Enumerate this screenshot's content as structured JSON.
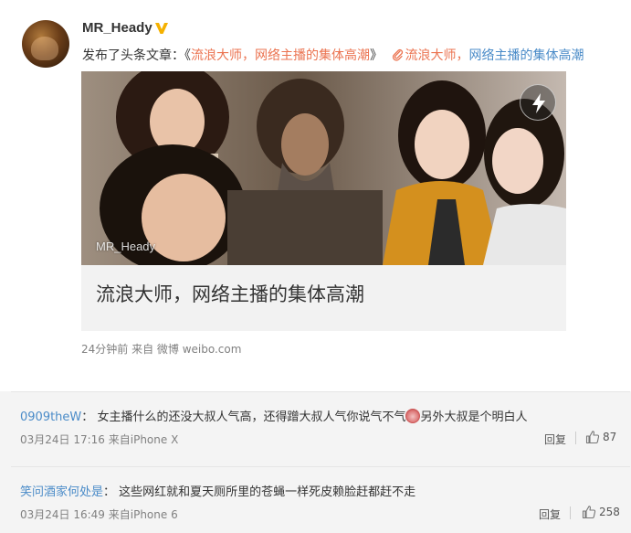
{
  "post": {
    "user_name": "MR_Heady",
    "action_text": "发布了头条文章：",
    "quote_open": "《",
    "quoted_title": "流浪大师，网络主播的集体高潮",
    "quote_close": "》",
    "link_part1": "流浪大师，",
    "link_part2": "网络主播的集体高潮",
    "article": {
      "watermark": "MR_Heady",
      "title": "流浪大师，网络主播的集体高潮"
    },
    "meta": "24分钟前 来自 微博 weibo.com"
  },
  "comments": [
    {
      "author": "0909theW",
      "separator": "：",
      "text_before_emoji": "女主播什么的还没大叔人气高，还得蹭大叔人气你说气不气",
      "text_after_emoji": "另外大叔是个明白人",
      "meta": "03月24日 17:16 来自iPhone X",
      "reply_label": "回复",
      "likes": "87"
    },
    {
      "author": "笑问酒家何处是",
      "separator": "：",
      "text_before_emoji": "这些网红就和夏天厕所里的苍蝇一样死皮赖脸赶都赶不走",
      "text_after_emoji": "",
      "meta": "03月24日 16:49 来自iPhone 6",
      "reply_label": "回复",
      "likes": "258"
    }
  ],
  "icons": {
    "vip": "vip-badge-icon",
    "clip": "link-clip-icon",
    "flash": "flash-icon",
    "like": "thumbs-up-icon",
    "emoji": "emoji-icon"
  },
  "colors": {
    "link_orange": "#eb7350",
    "link_blue": "#4a8bc8",
    "vip_gold": "#f5b100"
  }
}
